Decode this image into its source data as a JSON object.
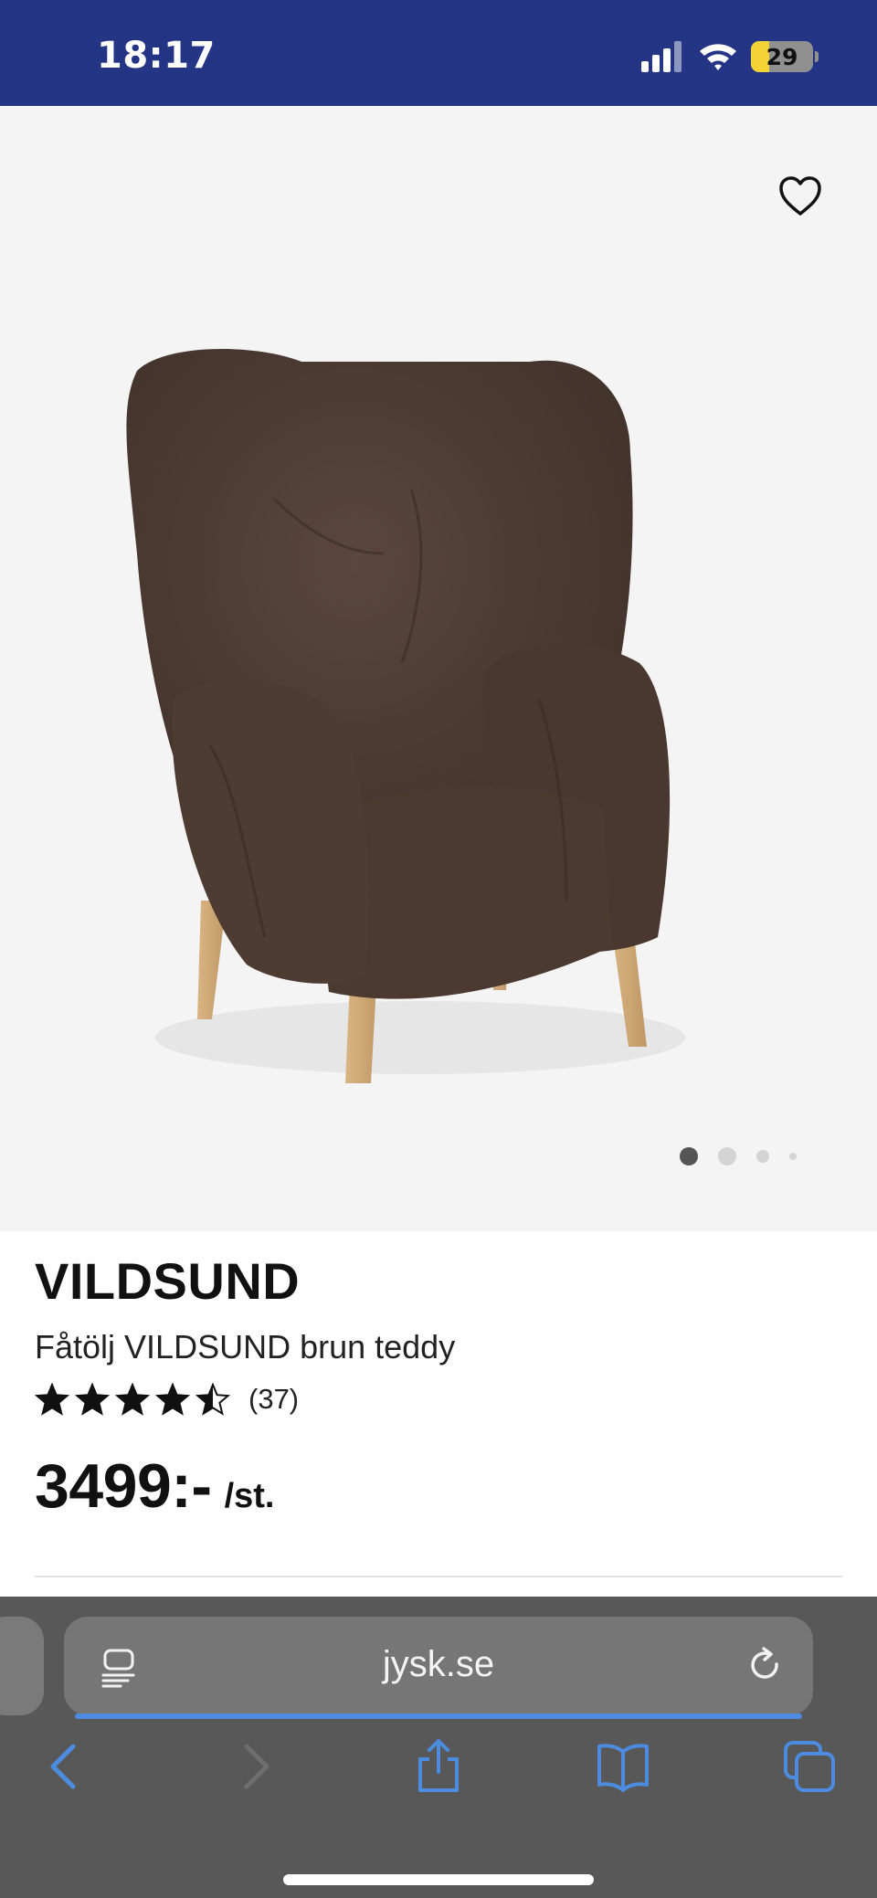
{
  "status_bar": {
    "time": "18:17",
    "battery": "29",
    "battery_level": 0.29,
    "icons": [
      "cellular-signal-icon",
      "wifi-icon",
      "battery-icon"
    ]
  },
  "gallery": {
    "image": "brown-teddy-armchair-photo",
    "favorite_icon": "heart-outline-icon",
    "page_count": 4,
    "active_index": 0
  },
  "product": {
    "brand": "VILDSUND",
    "name": "Fåtölj VILDSUND brun teddy",
    "rating": 4.5,
    "rating_max": 5,
    "review_count": "(37)",
    "price": "3499:-",
    "unit": "/st."
  },
  "browser": {
    "url": "jysk.se",
    "icons": [
      "tab-overview-icon",
      "reload-icon",
      "back-icon",
      "forward-icon",
      "share-icon",
      "bookmarks-icon",
      "tabs-icon"
    ]
  },
  "colors": {
    "status_bar_bg": "#233584",
    "accent_blue": "#4b8be0",
    "browser_bg": "#585858",
    "battery_yellow": "#f5d335"
  }
}
